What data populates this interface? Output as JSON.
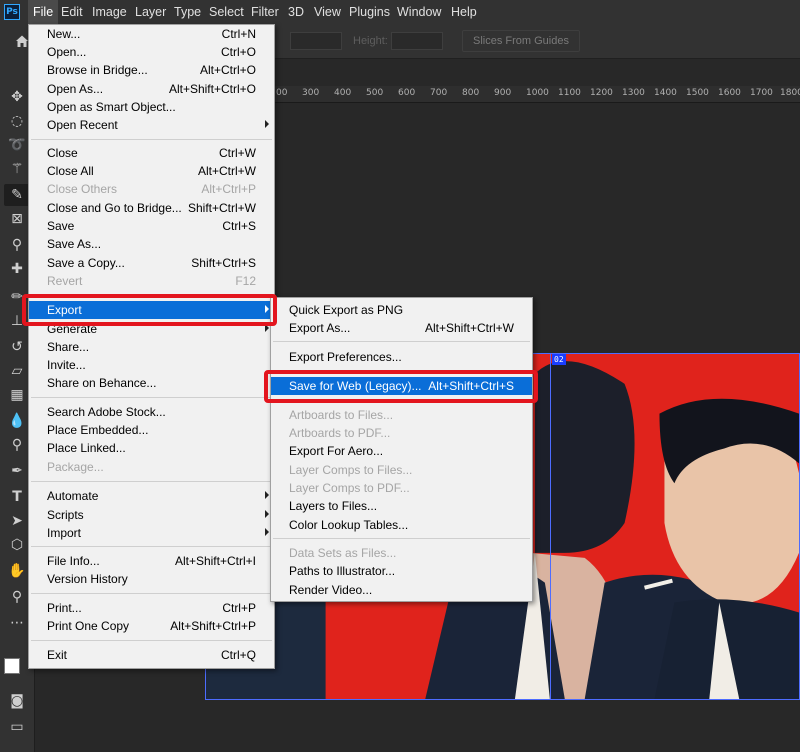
{
  "app": {
    "logo_text": "Ps"
  },
  "menubar": {
    "items": [
      "File",
      "Edit",
      "Image",
      "Layer",
      "Type",
      "Select",
      "Filter",
      "3D",
      "View",
      "Plugins",
      "Window",
      "Help"
    ],
    "active": "File"
  },
  "options_bar": {
    "height_label": "Height:",
    "slices_button": "Slices From Guides"
  },
  "ruler": {
    "labels": [
      "00",
      "300",
      "400",
      "500",
      "600",
      "700",
      "800",
      "900",
      "1000",
      "1100",
      "1200",
      "1300",
      "1400",
      "1500",
      "1600",
      "1700",
      "1800"
    ]
  },
  "artboard": {
    "tag": "02"
  },
  "file_menu": {
    "items": [
      {
        "label": "New...",
        "shortcut": "Ctrl+N"
      },
      {
        "label": "Open...",
        "shortcut": "Ctrl+O"
      },
      {
        "label": "Browse in Bridge...",
        "shortcut": "Alt+Ctrl+O"
      },
      {
        "label": "Open As...",
        "shortcut": "Alt+Shift+Ctrl+O"
      },
      {
        "label": "Open as Smart Object...",
        "shortcut": ""
      },
      {
        "label": "Open Recent",
        "shortcut": "",
        "submenu": true
      },
      {
        "label": "Close",
        "shortcut": "Ctrl+W"
      },
      {
        "label": "Close All",
        "shortcut": "Alt+Ctrl+W"
      },
      {
        "label": "Close Others",
        "shortcut": "Alt+Ctrl+P",
        "disabled": true
      },
      {
        "label": "Close and Go to Bridge...",
        "shortcut": "Shift+Ctrl+W"
      },
      {
        "label": "Save",
        "shortcut": "Ctrl+S"
      },
      {
        "label": "Save As...",
        "shortcut": ""
      },
      {
        "label": "Save a Copy...",
        "shortcut": "Shift+Ctrl+S"
      },
      {
        "label": "Revert",
        "shortcut": "F12",
        "disabled": true
      },
      {
        "label": "Export",
        "shortcut": "",
        "submenu": true,
        "highlighted": true
      },
      {
        "label": "Generate",
        "shortcut": "",
        "submenu": true
      },
      {
        "label": "Share...",
        "shortcut": ""
      },
      {
        "label": "Invite...",
        "shortcut": ""
      },
      {
        "label": "Share on Behance...",
        "shortcut": ""
      },
      {
        "label": "Search Adobe Stock...",
        "shortcut": ""
      },
      {
        "label": "Place Embedded...",
        "shortcut": ""
      },
      {
        "label": "Place Linked...",
        "shortcut": ""
      },
      {
        "label": "Package...",
        "shortcut": "",
        "disabled": true
      },
      {
        "label": "Automate",
        "shortcut": "",
        "submenu": true
      },
      {
        "label": "Scripts",
        "shortcut": "",
        "submenu": true
      },
      {
        "label": "Import",
        "shortcut": "",
        "submenu": true
      },
      {
        "label": "File Info...",
        "shortcut": "Alt+Shift+Ctrl+I"
      },
      {
        "label": "Version History",
        "shortcut": ""
      },
      {
        "label": "Print...",
        "shortcut": "Ctrl+P"
      },
      {
        "label": "Print One Copy",
        "shortcut": "Alt+Shift+Ctrl+P"
      },
      {
        "label": "Exit",
        "shortcut": "Ctrl+Q"
      }
    ]
  },
  "export_menu": {
    "items": [
      {
        "label": "Quick Export as PNG",
        "shortcut": ""
      },
      {
        "label": "Export As...",
        "shortcut": "Alt+Shift+Ctrl+W"
      },
      {
        "label": "Export Preferences...",
        "shortcut": ""
      },
      {
        "label": "Save for Web (Legacy)...",
        "shortcut": "Alt+Shift+Ctrl+S",
        "highlighted": true
      },
      {
        "label": "Artboards to Files...",
        "shortcut": "",
        "disabled": true
      },
      {
        "label": "Artboards to PDF...",
        "shortcut": "",
        "disabled": true
      },
      {
        "label": "Export For Aero...",
        "shortcut": ""
      },
      {
        "label": "Layer Comps to Files...",
        "shortcut": "",
        "disabled": true
      },
      {
        "label": "Layer Comps to PDF...",
        "shortcut": "",
        "disabled": true
      },
      {
        "label": "Layers to Files...",
        "shortcut": ""
      },
      {
        "label": "Color Lookup Tables...",
        "shortcut": ""
      },
      {
        "label": "Data Sets as Files...",
        "shortcut": "",
        "disabled": true
      },
      {
        "label": "Paths to Illustrator...",
        "shortcut": ""
      },
      {
        "label": "Render Video...",
        "shortcut": ""
      }
    ]
  },
  "colors": {
    "menu_highlight": "#0a6ed8",
    "callout_red": "#e3151e",
    "artwork_red": "#e0231c"
  }
}
